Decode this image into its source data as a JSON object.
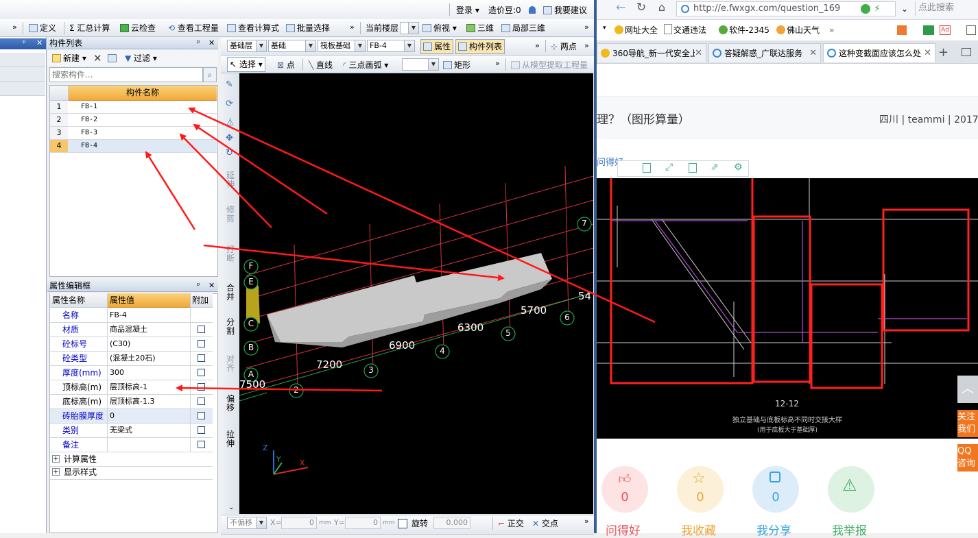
{
  "top_bar": {
    "login": "登录",
    "beans": "造价豆:0",
    "suggest": "我要建议"
  },
  "toolbar1": {
    "define": "定义",
    "summary": "汇总计算",
    "cloud_check": "云检查",
    "view_quantity": "查看工程量",
    "view_formula": "查看计算式",
    "batch_select": "批量选择",
    "current_floor": "当前楼层",
    "view_mode": "俯视",
    "three_d": "三维",
    "local_3d": "局部三维"
  },
  "component_list": {
    "title": "构件列表",
    "new_label": "新建",
    "filter_label": "过滤",
    "search_placeholder": "搜索构件...",
    "column_header": "构件名称",
    "rows": [
      {
        "no": "1",
        "name": "FB-1"
      },
      {
        "no": "2",
        "name": "FB-2"
      },
      {
        "no": "3",
        "name": "FB-3"
      },
      {
        "no": "4",
        "name": "FB-4"
      }
    ]
  },
  "toolbar2": {
    "layer": "基础层",
    "category": "基础",
    "type": "筏板基础",
    "component": "FB-4",
    "property_btn": "属性",
    "list_btn": "构件列表",
    "two_point": "两点"
  },
  "toolbar3": {
    "select": "选择",
    "point": "点",
    "line": "直线",
    "arc": "三点画弧",
    "rect": "矩形",
    "extract": "从模型提取工程量"
  },
  "property_editor": {
    "title": "属性编辑框",
    "col_name": "属性名称",
    "col_value": "属性值",
    "col_extra": "附加",
    "rows": [
      {
        "name": "名称",
        "value": "FB-4",
        "check": false
      },
      {
        "name": "材质",
        "value": "商品混凝土",
        "check": true
      },
      {
        "name": "砼标号",
        "value": "(C30)",
        "check": true
      },
      {
        "name": "砼类型",
        "value": "(混凝土20石)",
        "check": true
      },
      {
        "name": "厚度(mm)",
        "value": "300",
        "check": true
      },
      {
        "name": "顶标高(m)",
        "value": "层顶标高-1",
        "check": true
      },
      {
        "name": "底标高(m)",
        "value": "层顶标高-1.3",
        "check": true
      },
      {
        "name": "砖胎膜厚度",
        "value": "0",
        "check": true
      },
      {
        "name": "类别",
        "value": "无梁式",
        "check": true
      },
      {
        "name": "备注",
        "value": "",
        "check": true
      }
    ],
    "group1": "计算属性",
    "group2": "显示样式"
  },
  "side_tools": [
    "延伸",
    "修剪",
    "打断",
    "合并",
    "分割",
    "对齐",
    "偏移",
    "拉伸"
  ],
  "viewport": {
    "dims": [
      "7500",
      "7200",
      "6900",
      "6300",
      "5700",
      "54"
    ],
    "axis_numbers": [
      "2",
      "3",
      "4",
      "5",
      "6",
      "7"
    ],
    "axis_letters": [
      "F",
      "E",
      "C",
      "B",
      "A"
    ],
    "axis_z": "Z",
    "axis_y": "Y",
    "axis_x": "X"
  },
  "status_bar": {
    "no_offset": "不偏移",
    "x_label": "X=",
    "x_value": "0",
    "y_label": "Y=",
    "y_value": "0",
    "unit": "mm",
    "rotate": "旋转",
    "rotate_value": "0.000",
    "ortho": "正交",
    "intersection": "交点"
  },
  "browser": {
    "url": "http://e.fwxgx.com/question_169",
    "search_placeholder": "点此搜索",
    "bookmarks": [
      "网址大全",
      "交通违法",
      "软件-2345",
      "佛山天气"
    ],
    "tabs": [
      "360导航_新一代安全上",
      "答疑解惑_广联达服务",
      "这种变截面应该怎么处"
    ],
    "page_title": "理？（图形算量）",
    "meta": "四川 | teammi | 2017",
    "link_text": "问得好",
    "drawing_title": "12-12",
    "drawing_caption": "独立基础与底板标高不同时交接大样",
    "drawing_subcaption": "(用于底板大于基础厚)",
    "follow": "关注我们",
    "qq": "QQ咨询",
    "stats": [
      {
        "label": "问得好",
        "value": "0",
        "color": "#e8545c"
      },
      {
        "label": "我收藏",
        "value": "0",
        "color": "#eaa63a"
      },
      {
        "label": "我分享",
        "value": "0",
        "color": "#3aa3e0"
      },
      {
        "label": "我举报",
        "value": "",
        "color": "#45b06a"
      }
    ]
  }
}
